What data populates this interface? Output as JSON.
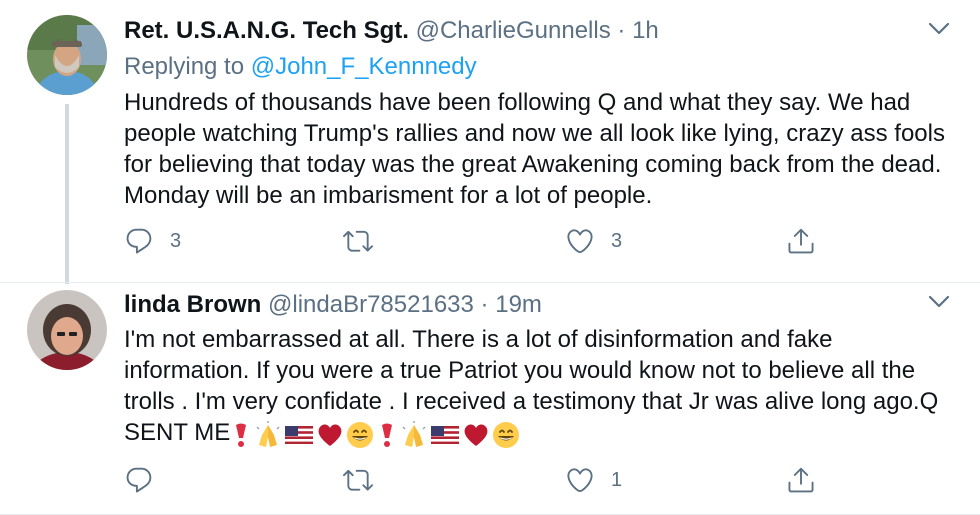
{
  "tweets": [
    {
      "name": "Ret. U.S.A.N.G. Tech Sgt.",
      "handle": "@CharlieGunnells",
      "separator": "·",
      "time": "1h",
      "replying_label": "Replying to",
      "replying_to": "@John_F_Kennnedy",
      "text": "Hundreds of thousands have been following Q and what they say. We had people watching Trump's rallies and now we all look like lying, crazy ass fools for believing that today was the great Awakening coming back from the dead. Monday will be an imbarisment for a lot of people.",
      "reply_count": "3",
      "retweet_count": "",
      "like_count": "3"
    },
    {
      "name": "linda Brown",
      "handle": "@lindaBr78521633",
      "separator": "·",
      "time": "19m",
      "text": "I'm not embarrassed at all.  There is a lot of disinformation and fake information. If you were a true Patriot you would know not to believe all the trolls . I'm very confidate . I received a testimony that Jr was alive long ago.Q SENT ME",
      "emojis": [
        "exclamation-icon",
        "praying-hands-icon",
        "us-flag-icon",
        "heart-icon",
        "grinning-face-icon",
        "exclamation-icon",
        "praying-hands-icon",
        "us-flag-icon",
        "heart-icon",
        "grinning-face-icon"
      ],
      "reply_count": "",
      "retweet_count": "",
      "like_count": "1"
    }
  ],
  "colors": {
    "text": "#0f1419",
    "secondary": "#5b7083",
    "link": "#1da1f2",
    "thread_line": "#cfd9de",
    "divider": "#e6ecf0"
  }
}
